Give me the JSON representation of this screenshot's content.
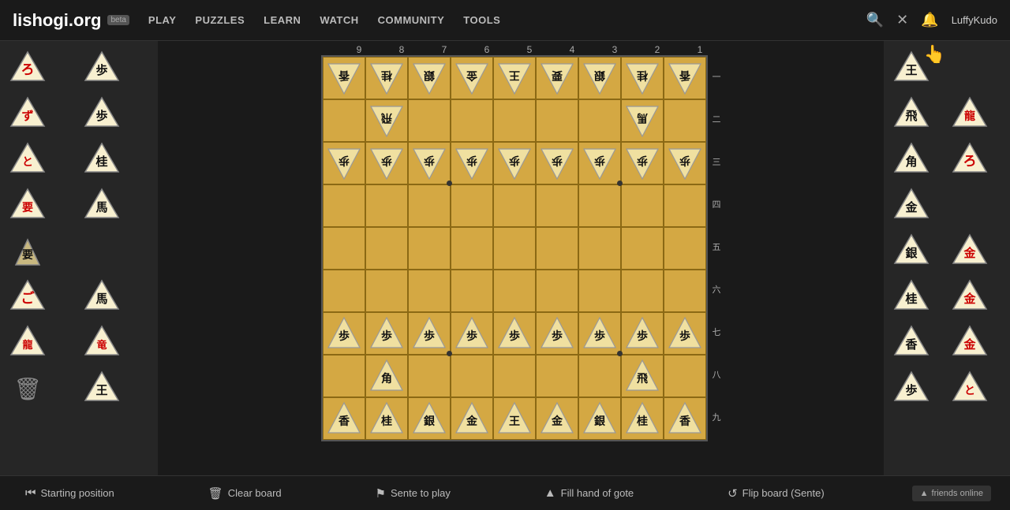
{
  "header": {
    "logo": "lishogi.org",
    "beta": "beta",
    "nav": [
      "PLAY",
      "PUZZLES",
      "LEARN",
      "WATCH",
      "COMMUNITY",
      "TOOLS"
    ],
    "username": "LuffyKudo"
  },
  "board": {
    "col_labels": [
      "9",
      "8",
      "7",
      "6",
      "5",
      "4",
      "3",
      "2",
      "1"
    ],
    "row_labels": [
      "一",
      "二",
      "三",
      "四",
      "五",
      "六",
      "七",
      "八",
      "九"
    ]
  },
  "footer": {
    "starting_position": "Starting position",
    "clear_board": "Clear board",
    "sente_to_play": "Sente to play",
    "fill_hand": "Fill hand of gote",
    "flip_board": "Flip board (Sente)",
    "friends_online": "friends online"
  }
}
